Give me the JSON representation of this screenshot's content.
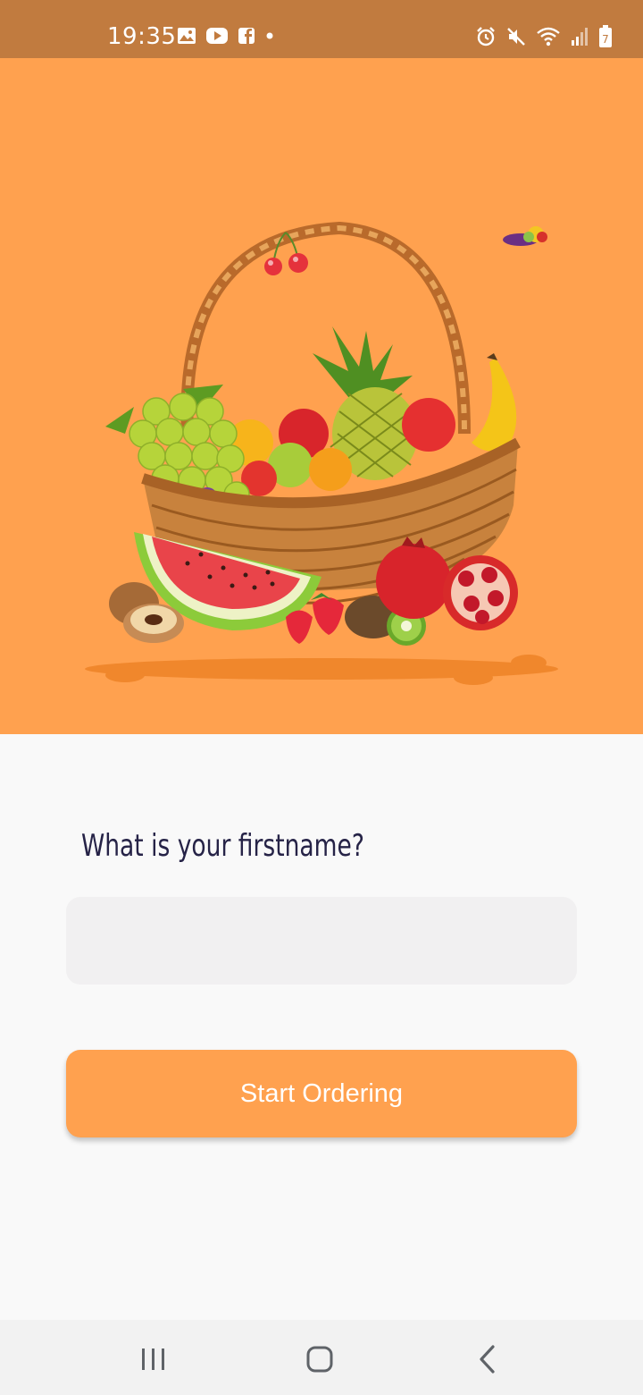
{
  "status_bar": {
    "time": "19:35",
    "left_icons": [
      "gallery-icon",
      "youtube-icon",
      "facebook-icon",
      "dot-icon"
    ],
    "right_icons": [
      "alarm-icon",
      "mute-icon",
      "wifi-icon",
      "signal-icon",
      "battery-icon"
    ],
    "battery_level": "7"
  },
  "hero": {
    "image": "fruit-basket-illustration",
    "background_color": "#ffa14f"
  },
  "form": {
    "question": "What is your firstname?",
    "name_value": "",
    "name_placeholder": "",
    "start_label": "Start Ordering"
  },
  "nav_bar": {
    "buttons": [
      "recent-apps-icon",
      "home-icon",
      "back-icon"
    ]
  },
  "colors": {
    "status_bar": "#c17b3f",
    "accent": "#ffa14f",
    "input_bg": "#f1f0f1",
    "question_text": "#262347"
  }
}
